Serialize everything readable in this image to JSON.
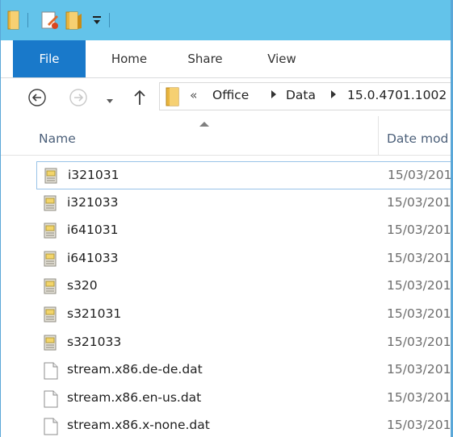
{
  "ribbon": {
    "tabs": [
      "File",
      "Home",
      "Share",
      "View"
    ]
  },
  "address": {
    "overflow": "«",
    "crumbs": [
      "Office",
      "Data",
      "15.0.4701.1002"
    ]
  },
  "columns": {
    "name": "Name",
    "date": "Date mod"
  },
  "files": [
    {
      "name": "i321031",
      "date": "15/03/201",
      "type": "config"
    },
    {
      "name": "i321033",
      "date": "15/03/201",
      "type": "config"
    },
    {
      "name": "i641031",
      "date": "15/03/201",
      "type": "config"
    },
    {
      "name": "i641033",
      "date": "15/03/201",
      "type": "config"
    },
    {
      "name": "s320",
      "date": "15/03/201",
      "type": "config"
    },
    {
      "name": "s321031",
      "date": "15/03/201",
      "type": "config"
    },
    {
      "name": "s321033",
      "date": "15/03/201",
      "type": "config"
    },
    {
      "name": "stream.x86.de-de.dat",
      "date": "15/03/201",
      "type": "blank"
    },
    {
      "name": "stream.x86.en-us.dat",
      "date": "15/03/201",
      "type": "blank"
    },
    {
      "name": "stream.x86.x-none.dat",
      "date": "15/03/201",
      "type": "blank"
    }
  ],
  "colors": {
    "titlebar": "#63c3ea",
    "file_tab": "#1979ca",
    "focus_border": "#99c3e8"
  }
}
